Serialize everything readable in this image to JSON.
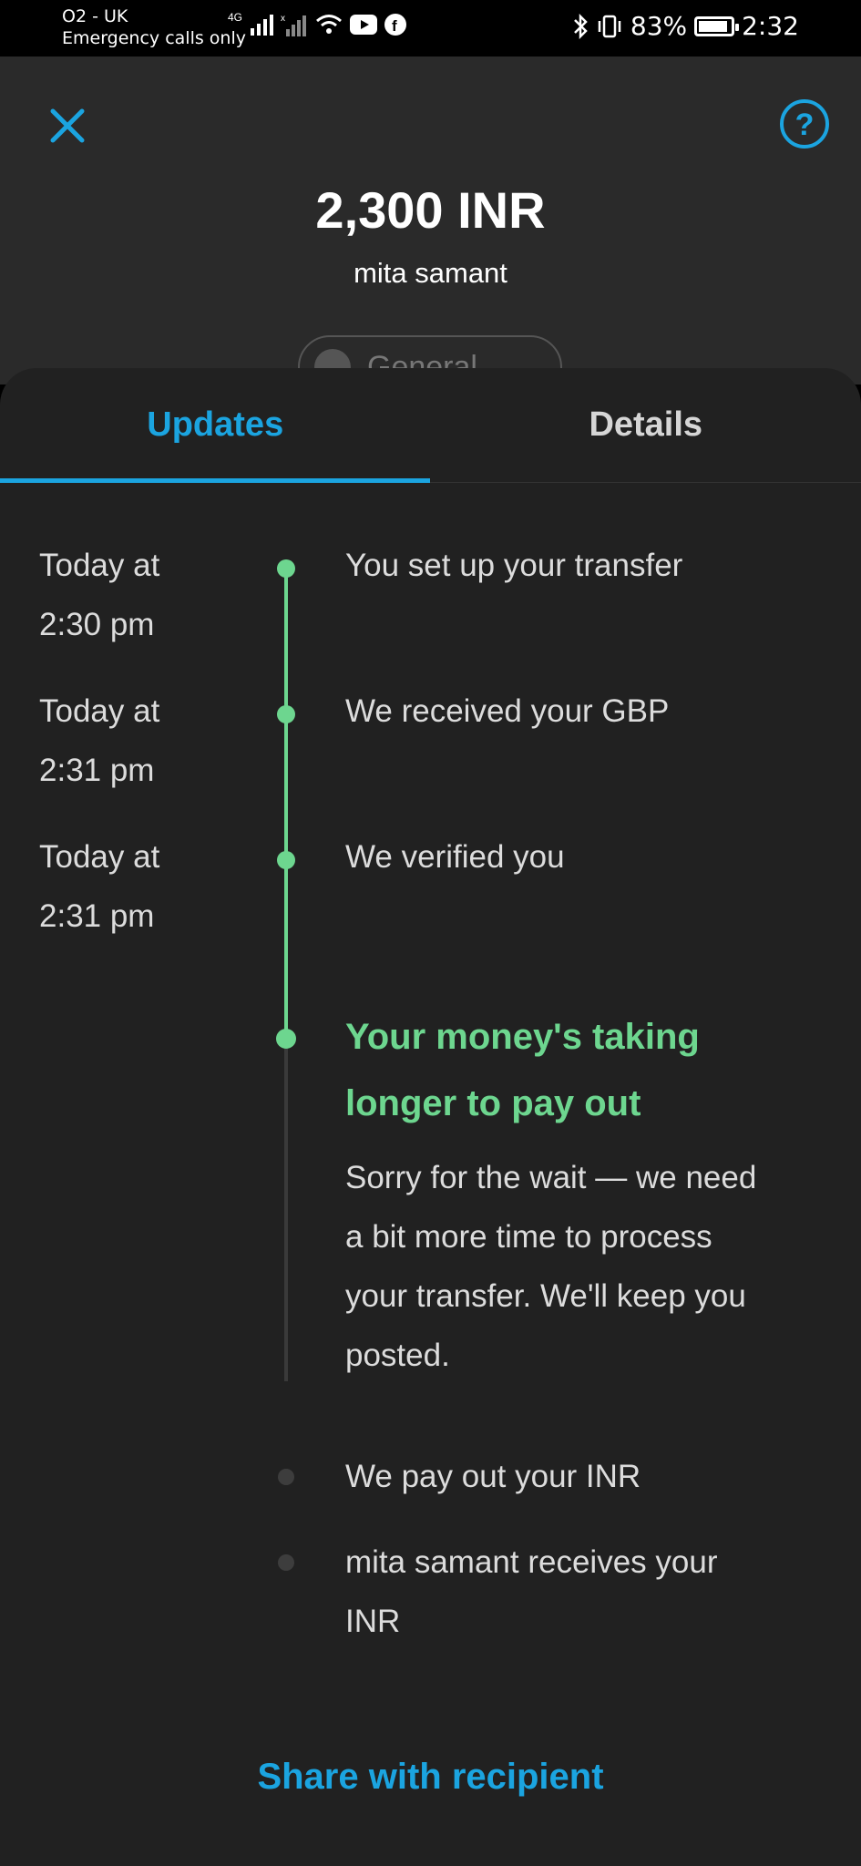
{
  "status_bar": {
    "carrier": "O2 - UK",
    "carrier_sub": "Emergency calls only",
    "network_type": "4G",
    "battery_percent": "83%",
    "battery_level": 0.83,
    "time": "2:32"
  },
  "header": {
    "amount": "2,300 INR",
    "recipient_name": "mita samant",
    "category_pill": "General"
  },
  "tabs": [
    {
      "label": "Updates",
      "active": true
    },
    {
      "label": "Details",
      "active": false
    }
  ],
  "timeline": {
    "events": [
      {
        "time_line1": "Today at",
        "time_line2": "2:30 pm",
        "text": "You set up your transfer",
        "status": "done"
      },
      {
        "time_line1": "Today at",
        "time_line2": "2:31 pm",
        "text": "We received your GBP",
        "status": "done"
      },
      {
        "time_line1": "Today at",
        "time_line2": "2:31 pm",
        "text": "We verified you",
        "status": "done"
      }
    ],
    "current": {
      "heading_line1": "Your money's taking",
      "heading_line2": "longer to pay out",
      "body_line1": "Sorry for the wait — we need",
      "body_line2": "a bit more time to process",
      "body_line3": "your transfer. We'll keep you",
      "body_line4": "posted."
    },
    "pending": [
      {
        "text": "We pay out your INR"
      },
      {
        "text_line1": "mita samant receives your",
        "text_line2": "INR"
      }
    ]
  },
  "actions": {
    "share_label": "Share with recipient"
  },
  "colors": {
    "accent": "#1ba4e0",
    "success": "#6dd68f",
    "background": "#212121"
  }
}
